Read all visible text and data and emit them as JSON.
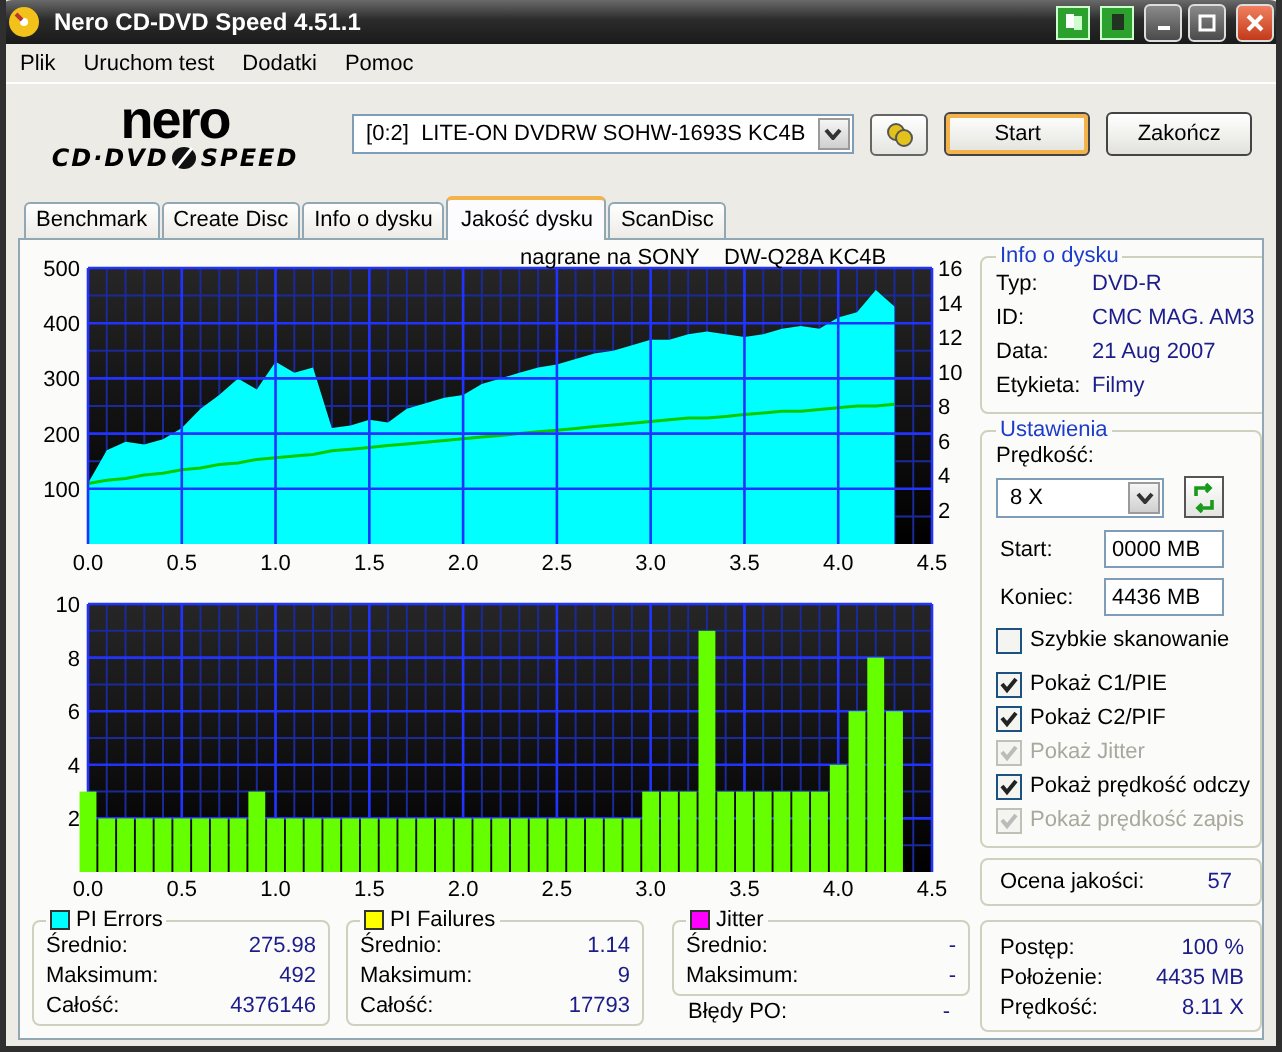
{
  "window": {
    "title": "Nero CD-DVD Speed 4.51.1"
  },
  "menu": [
    {
      "label": "Plik"
    },
    {
      "label": "Uruchom test"
    },
    {
      "label": "Dodatki"
    },
    {
      "label": "Pomoc"
    }
  ],
  "logo": {
    "name": "nero",
    "product_left": "CD·DVD",
    "product_right": "SPEED"
  },
  "drive_select": {
    "value": "[0:2]  LITE-ON DVDRW SOHW-1693S KC4B"
  },
  "buttons": [
    {
      "label": "Start",
      "default": true
    },
    {
      "label": "Zakończ",
      "default": false
    }
  ],
  "tabs": [
    {
      "label": "Benchmark",
      "selected": false
    },
    {
      "label": "Create Disc",
      "selected": false
    },
    {
      "label": "Info o dysku",
      "selected": false
    },
    {
      "label": "Jakość dysku",
      "selected": true
    },
    {
      "label": "ScanDisc",
      "selected": false
    }
  ],
  "chart_top": {
    "title": "nagrane na SONY",
    "drive_label": "DW-Q28A KC4B",
    "chart_data": {
      "type": "area",
      "grid": true,
      "xlim": [
        0,
        4.5
      ],
      "ylim": [
        0,
        500
      ],
      "y2lim": [
        0,
        16
      ],
      "x": [
        0,
        0.1,
        0.2,
        0.3,
        0.4,
        0.5,
        0.6,
        0.7,
        0.8,
        0.9,
        1.0,
        1.1,
        1.2,
        1.3,
        1.4,
        1.5,
        1.6,
        1.7,
        1.8,
        1.9,
        2.0,
        2.1,
        2.2,
        2.3,
        2.4,
        2.5,
        2.6,
        2.7,
        2.8,
        2.9,
        3.0,
        3.1,
        3.2,
        3.3,
        3.4,
        3.5,
        3.6,
        3.7,
        3.8,
        3.9,
        4.0,
        4.1,
        4.2,
        4.3
      ],
      "series": [
        {
          "color": "#00ffff",
          "values": [
            110,
            170,
            185,
            180,
            190,
            210,
            245,
            270,
            300,
            280,
            330,
            310,
            320,
            210,
            215,
            225,
            220,
            245,
            255,
            265,
            270,
            290,
            300,
            310,
            320,
            325,
            335,
            345,
            350,
            360,
            370,
            370,
            380,
            385,
            380,
            375,
            380,
            390,
            395,
            390,
            410,
            420,
            460,
            430
          ]
        },
        {
          "type": "line",
          "axis": "y2",
          "color": "#00cc00",
          "values": [
            3.5,
            3.7,
            3.8,
            4.0,
            4.1,
            4.3,
            4.4,
            4.6,
            4.7,
            4.9,
            5.0,
            5.1,
            5.2,
            5.4,
            5.5,
            5.6,
            5.7,
            5.8,
            5.9,
            6.0,
            6.1,
            6.2,
            6.3,
            6.4,
            6.5,
            6.6,
            6.7,
            6.8,
            6.9,
            7.0,
            7.1,
            7.2,
            7.3,
            7.3,
            7.4,
            7.5,
            7.6,
            7.7,
            7.7,
            7.8,
            7.9,
            8.0,
            8.0,
            8.1
          ]
        }
      ],
      "xticks": [
        {
          "value": 0,
          "label": "0.0"
        },
        {
          "value": 0.5,
          "label": "0.5"
        },
        {
          "value": 1,
          "label": "1.0"
        },
        {
          "value": 1.5,
          "label": "1.5"
        },
        {
          "value": 2,
          "label": "2.0"
        },
        {
          "value": 2.5,
          "label": "2.5"
        },
        {
          "value": 3,
          "label": "3.0"
        },
        {
          "value": 3.5,
          "label": "3.5"
        },
        {
          "value": 4,
          "label": "4.0"
        },
        {
          "value": 4.5,
          "label": "4.5"
        }
      ],
      "yticks": [
        100,
        200,
        300,
        400,
        500
      ],
      "y2ticks": [
        2,
        4,
        6,
        8,
        10,
        12,
        14,
        16
      ]
    }
  },
  "chart_bottom": {
    "chart_data": {
      "type": "bar",
      "grid": true,
      "xlim": [
        0,
        4.5
      ],
      "ylim": [
        0,
        10
      ],
      "x": [
        0,
        0.1,
        0.2,
        0.3,
        0.4,
        0.5,
        0.6,
        0.7,
        0.8,
        0.9,
        1.0,
        1.1,
        1.2,
        1.3,
        1.4,
        1.5,
        1.6,
        1.7,
        1.8,
        1.9,
        2.0,
        2.1,
        2.2,
        2.3,
        2.4,
        2.5,
        2.6,
        2.7,
        2.8,
        2.9,
        3.0,
        3.1,
        3.2,
        3.3,
        3.4,
        3.5,
        3.6,
        3.7,
        3.8,
        3.9,
        4.0,
        4.1,
        4.2,
        4.3
      ],
      "series": [
        {
          "color": "#66ff00",
          "values": [
            3,
            2,
            2,
            2,
            2,
            2,
            2,
            2,
            2,
            3,
            2,
            2,
            2,
            2,
            2,
            2,
            2,
            2,
            2,
            2,
            2,
            2,
            2,
            2,
            2,
            2,
            2,
            2,
            2,
            2,
            3,
            3,
            3,
            9,
            3,
            3,
            3,
            3,
            3,
            3,
            4,
            6,
            8,
            6
          ]
        }
      ],
      "xticks": [
        {
          "value": 0,
          "label": "0.0"
        },
        {
          "value": 0.5,
          "label": "0.5"
        },
        {
          "value": 1,
          "label": "1.0"
        },
        {
          "value": 1.5,
          "label": "1.5"
        },
        {
          "value": 2,
          "label": "2.0"
        },
        {
          "value": 2.5,
          "label": "2.5"
        },
        {
          "value": 3,
          "label": "3.0"
        },
        {
          "value": 3.5,
          "label": "3.5"
        },
        {
          "value": 4,
          "label": "4.0"
        },
        {
          "value": 4.5,
          "label": "4.5"
        }
      ],
      "yticks": [
        2,
        4,
        6,
        8,
        10
      ]
    }
  },
  "disc_info": {
    "title": "Info o dysku",
    "rows": [
      {
        "label": "Typ:",
        "value": "DVD-R"
      },
      {
        "label": "ID:",
        "value": "CMC MAG. AM3"
      },
      {
        "label": "Data:",
        "value": "21 Aug 2007"
      },
      {
        "label": "Etykieta:",
        "value": "Filmy"
      }
    ]
  },
  "settings": {
    "title": "Ustawienia",
    "speed_label": "Prędkość:",
    "speed_value": "8 X",
    "start_label": "Start:",
    "start_value": "0000 MB",
    "end_label": "Koniec:",
    "end_value": "4436 MB",
    "options": [
      {
        "label": "Szybkie skanowanie",
        "checked": false,
        "disabled": false
      },
      {
        "label": "Pokaż C1/PIE",
        "checked": true,
        "disabled": false
      },
      {
        "label": "Pokaż C2/PIF",
        "checked": true,
        "disabled": false
      },
      {
        "label": "Pokaż Jitter",
        "checked": true,
        "disabled": true
      },
      {
        "label": "Pokaż prędkość odczy",
        "checked": true,
        "disabled": false
      },
      {
        "label": "Pokaż prędkość zapis",
        "checked": true,
        "disabled": true
      }
    ]
  },
  "quality": {
    "label": "Ocena jakości:",
    "value": "57"
  },
  "stats": [
    {
      "title": "PI Errors",
      "color": "#00ffff",
      "rows": [
        {
          "label": "Średnio:",
          "value": "275.98"
        },
        {
          "label": "Maksimum:",
          "value": "492"
        },
        {
          "label": "Całość:",
          "value": "4376146"
        }
      ]
    },
    {
      "title": "PI Failures",
      "color": "#ffff00",
      "rows": [
        {
          "label": "Średnio:",
          "value": "1.14"
        },
        {
          "label": "Maksimum:",
          "value": "9"
        },
        {
          "label": "Całość:",
          "value": "17793"
        }
      ]
    },
    {
      "title": "Jitter",
      "color": "#ff00ff",
      "rows": [
        {
          "label": "Średnio:",
          "value": "-"
        },
        {
          "label": "Maksimum:",
          "value": "-"
        }
      ]
    }
  ],
  "po_errors": {
    "label": "Błędy PO:",
    "value": "-"
  },
  "progress": {
    "rows": [
      {
        "label": "Postęp:",
        "value": "100 %"
      },
      {
        "label": "Położenie:",
        "value": "4435 MB"
      },
      {
        "label": "Prędkość:",
        "value": "8.11 X"
      }
    ]
  }
}
